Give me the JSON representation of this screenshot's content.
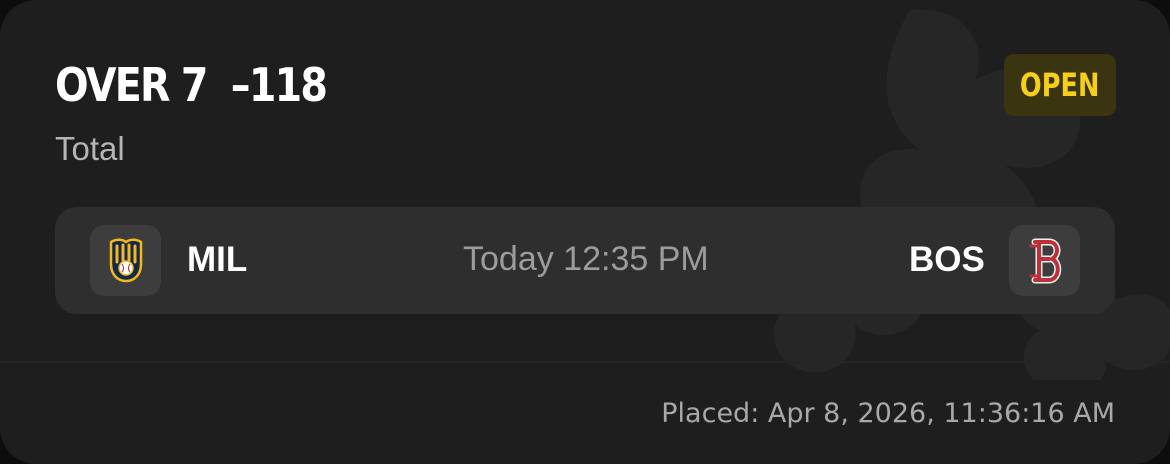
{
  "bet": {
    "title": "OVER 7  –118",
    "type": "Total",
    "status": "OPEN"
  },
  "game": {
    "away_team": "MIL",
    "home_team": "BOS",
    "time": "Today 12:35 PM",
    "away_logo_icon": "brewers-logo-icon",
    "home_logo_icon": "red-sox-logo-icon"
  },
  "footer": {
    "placed": "Placed: Apr 8, 2026, 11:36:16 AM"
  },
  "colors": {
    "card_bg": "#1e1e1e",
    "status_text": "#f6cf1b",
    "status_bg": "#3a3410",
    "brewers_gold": "#f2b81d",
    "brewers_navy": "#13294b",
    "red_sox_red": "#bd3039"
  }
}
